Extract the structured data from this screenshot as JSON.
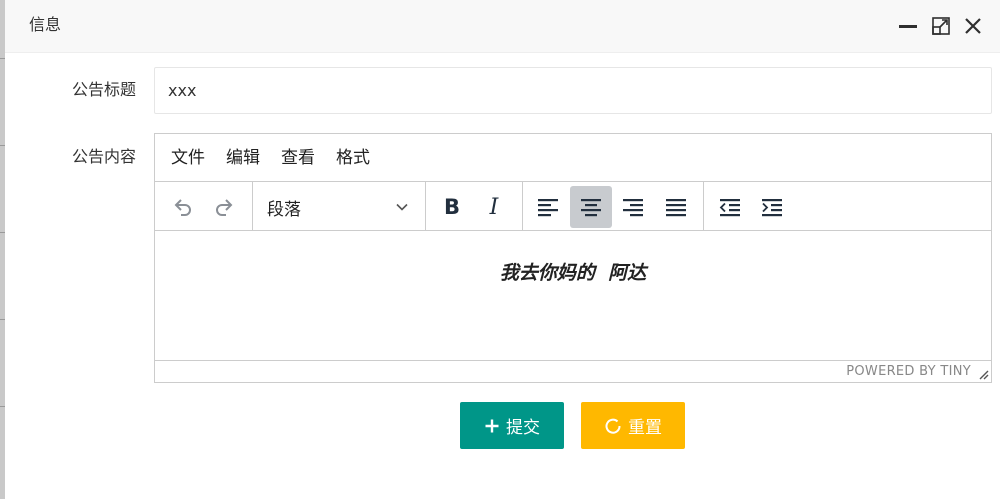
{
  "dialog": {
    "title": "信息",
    "minimize_icon": "minimize-icon",
    "maximize_icon": "maximize-icon",
    "close_icon": "close-icon"
  },
  "form": {
    "title_label": "公告标题",
    "title_value": "xxx",
    "content_label": "公告内容"
  },
  "editor": {
    "menu": [
      "文件",
      "编辑",
      "查看",
      "格式"
    ],
    "toolbar": {
      "undo_icon": "undo-icon",
      "redo_icon": "redo-icon",
      "block_format": "段落",
      "bold": "B",
      "italic": "I",
      "align_left_icon": "align-left-icon",
      "align_center_icon": "align-center-icon",
      "align_center_active": true,
      "align_right_icon": "align-right-icon",
      "align_justify_icon": "align-justify-icon",
      "outdent_icon": "outdent-icon",
      "indent_icon": "indent-icon"
    },
    "content": "我去你妈的  阿达",
    "powered_by": "POWERED BY TINY"
  },
  "buttons": {
    "submit_label": "提交",
    "reset_label": "重置"
  },
  "colors": {
    "submit": "#009688",
    "reset": "#ffb800",
    "active_tool": "#c8cbcf"
  }
}
